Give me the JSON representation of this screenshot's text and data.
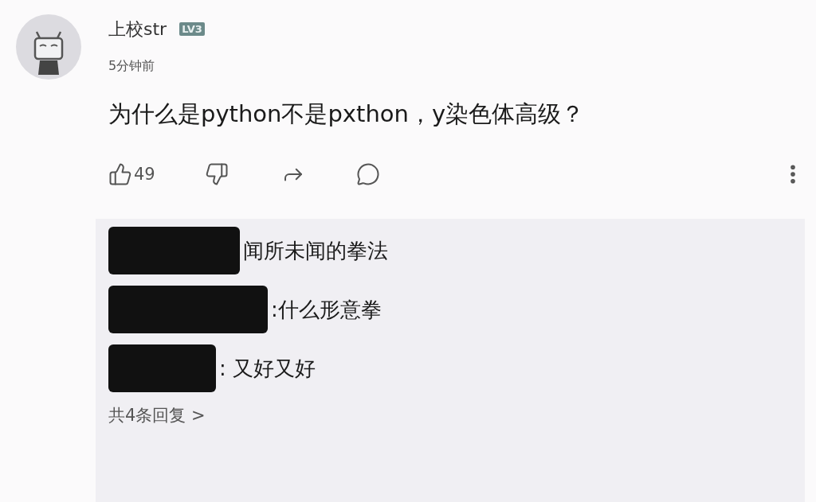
{
  "comment": {
    "username": "上校str",
    "level_badge": "LV3",
    "time": "5分钟前",
    "text": "为什么是python不是pxthon，y染色体高级？",
    "likes": "49"
  },
  "replies": [
    {
      "text": "闻所未闻的拳法"
    },
    {
      "text": ":什么形意拳"
    },
    {
      "text": ": 又好又好"
    }
  ],
  "more_replies": "共4条回复 >"
}
